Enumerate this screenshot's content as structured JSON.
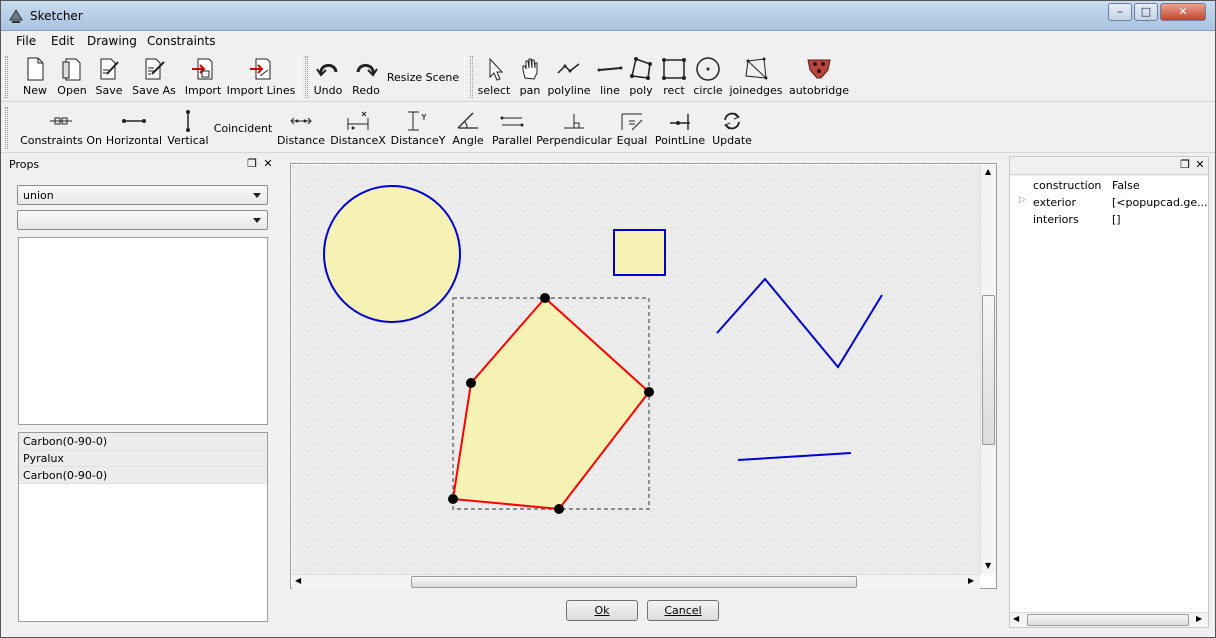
{
  "window": {
    "title": "Sketcher"
  },
  "menus": [
    "File",
    "Edit",
    "Drawing",
    "Constraints"
  ],
  "toolbar1": {
    "new": "New",
    "open": "Open",
    "save": "Save",
    "save_as": "Save As",
    "import": "Import",
    "import_lines": "Import Lines",
    "undo": "Undo",
    "redo": "Redo",
    "resize_scene": "Resize Scene",
    "select": "select",
    "pan": "pan",
    "polyline": "polyline",
    "line": "line",
    "poly": "poly",
    "rect": "rect",
    "circle": "circle",
    "joinedges": "joinedges",
    "autobridge": "autobridge"
  },
  "toolbar2": {
    "constraints_on": "Constraints On",
    "horizontal": "Horizontal",
    "vertical": "Vertical",
    "coincident": "Coincident",
    "distance": "Distance",
    "distance_x": "DistanceX",
    "distance_y": "DistanceY",
    "angle": "Angle",
    "parallel": "Parallel",
    "perpendicular": "Perpendicular",
    "equal": "Equal",
    "point_line": "PointLine",
    "update": "Update"
  },
  "props_panel": {
    "title": "Props",
    "combo1_value": "union",
    "combo2_value": "",
    "layers": [
      "Carbon(0-90-0)",
      "Pyralux",
      "Carbon(0-90-0)"
    ]
  },
  "properties": [
    {
      "key": "construction",
      "value": "False",
      "expandable": false
    },
    {
      "key": "exterior",
      "value": "[<popupcad.ge...",
      "expandable": true
    },
    {
      "key": "interiors",
      "value": "[]",
      "expandable": false
    }
  ],
  "dialog_buttons": {
    "ok": "Ok",
    "cancel": "Cancel"
  },
  "colors": {
    "fill": "#f5f2b4",
    "outline": "#0000d0",
    "selected_edge": "#ff0000",
    "vertex": "#000000",
    "canvas": "#ececec"
  }
}
